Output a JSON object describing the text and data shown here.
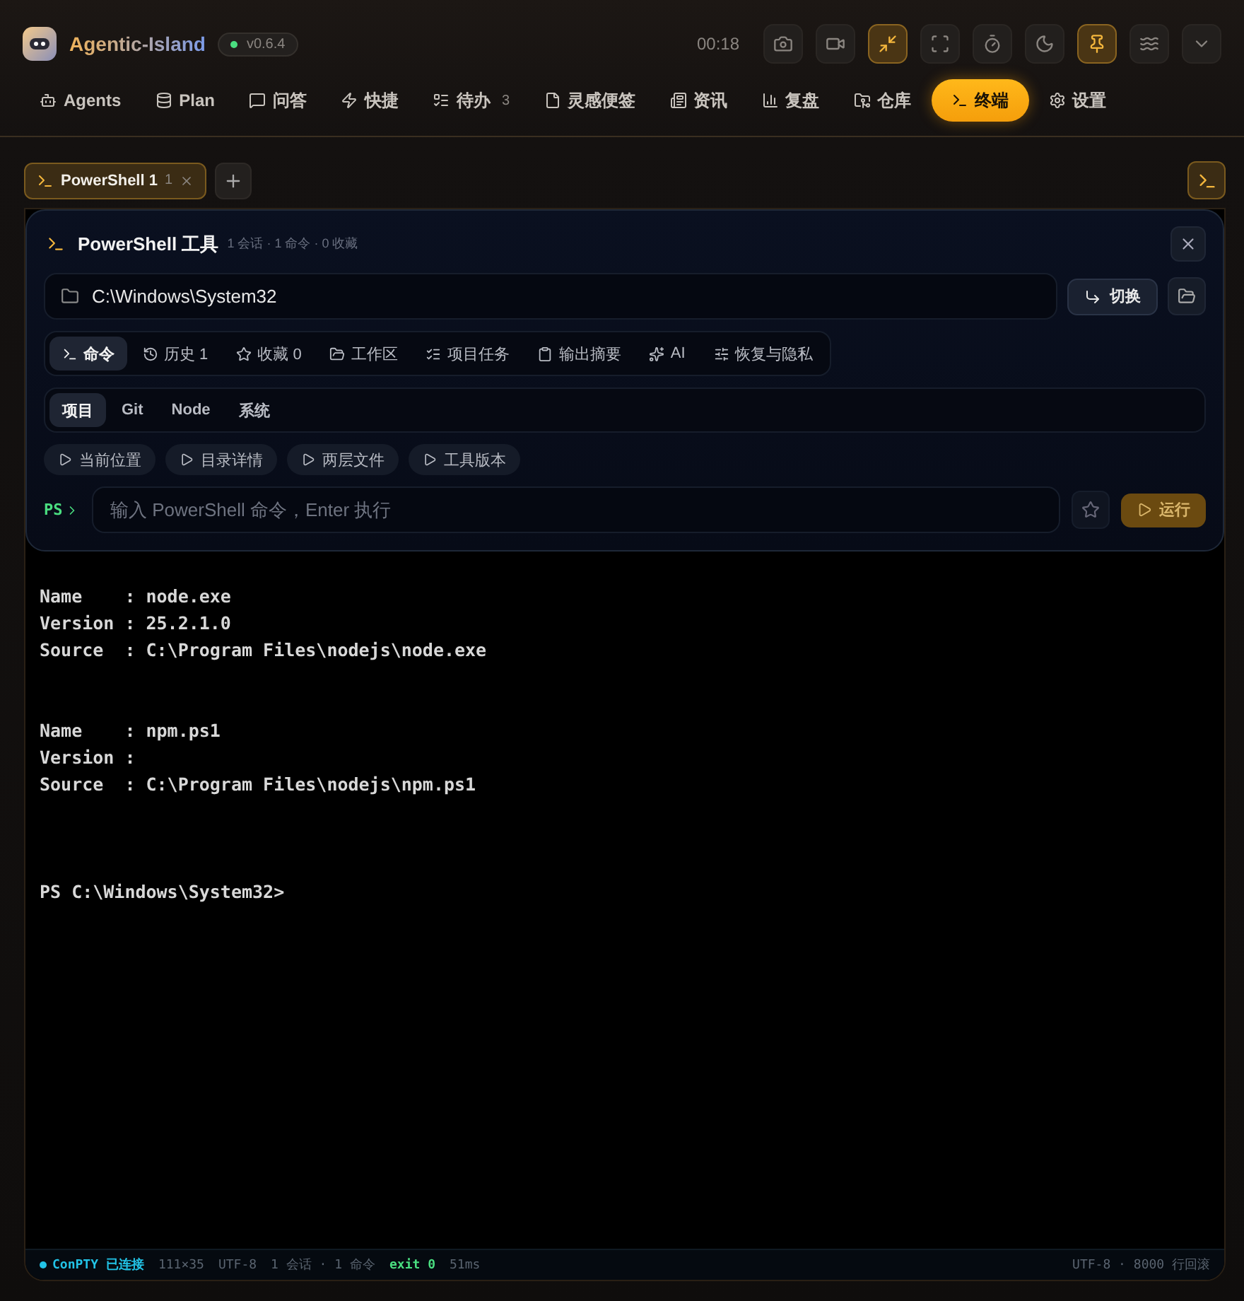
{
  "app": {
    "name": "Agentic-Island",
    "version": "v0.6.4",
    "timer": "00:18"
  },
  "header_buttons": [
    {
      "active": false
    },
    {
      "active": false
    },
    {
      "active": true
    },
    {
      "active": false
    },
    {
      "active": false
    },
    {
      "active": false
    },
    {
      "active": true
    },
    {
      "active": false
    },
    {
      "active": false
    }
  ],
  "nav": [
    {
      "label": "Agents",
      "selected": false
    },
    {
      "label": "Plan",
      "selected": false
    },
    {
      "label": "问答",
      "selected": false
    },
    {
      "label": "快捷",
      "selected": false
    },
    {
      "label": "待办",
      "count": "3",
      "selected": false
    },
    {
      "label": "灵感便签",
      "selected": false
    },
    {
      "label": "资讯",
      "selected": false
    },
    {
      "label": "复盘",
      "selected": false
    },
    {
      "label": "仓库",
      "selected": false
    },
    {
      "label": "终端",
      "selected": true
    },
    {
      "label": "设置",
      "selected": false
    }
  ],
  "sessions": [
    {
      "label": "PowerShell 1",
      "count": "1",
      "selected": true
    }
  ],
  "tool": {
    "title": "PowerShell 工具",
    "summary": "1 会话 · 1 命令 · 0 收藏",
    "path": "C:\\Windows\\System32",
    "switch_label": "切换",
    "tabs": [
      {
        "label": "命令",
        "selected": true
      },
      {
        "label": "历史 1",
        "selected": false
      },
      {
        "label": "收藏 0",
        "selected": false
      },
      {
        "label": "工作区",
        "selected": false
      },
      {
        "label": "项目任务",
        "selected": false
      },
      {
        "label": "输出摘要",
        "selected": false
      },
      {
        "label": "AI",
        "selected": false
      },
      {
        "label": "恢复与隐私",
        "selected": false
      }
    ],
    "categories": [
      {
        "label": "项目",
        "selected": true
      },
      {
        "label": "Git",
        "selected": false
      },
      {
        "label": "Node",
        "selected": false
      },
      {
        "label": "系统",
        "selected": false
      }
    ],
    "quick_commands": [
      "当前位置",
      "目录详情",
      "两层文件",
      "工具版本"
    ],
    "prompt_label": "PS",
    "input_placeholder": "输入 PowerShell 命令，Enter 执行",
    "run_label": "运行"
  },
  "output": [
    {
      "kind": "record",
      "lines": [
        "Name    : node.exe",
        "Version : 25.2.1.0",
        "Source  : C:\\Program Files\\nodejs\\node.exe"
      ]
    },
    {
      "kind": "record",
      "lines": [
        "Name    : npm.ps1",
        "Version :",
        "Source  : C:\\Program Files\\nodejs\\npm.ps1"
      ]
    },
    {
      "kind": "prompt",
      "lines": [
        "PS C:\\Windows\\System32>"
      ]
    }
  ],
  "status_bar": {
    "connection": "ConPTY 已连接",
    "connected": true,
    "size": "111×35",
    "encoding": "UTF-8",
    "sessions": "1 会话 · 1 命令",
    "exit": "exit 0",
    "duration": "51ms",
    "right": "UTF-8 · 8000 行回滚"
  }
}
